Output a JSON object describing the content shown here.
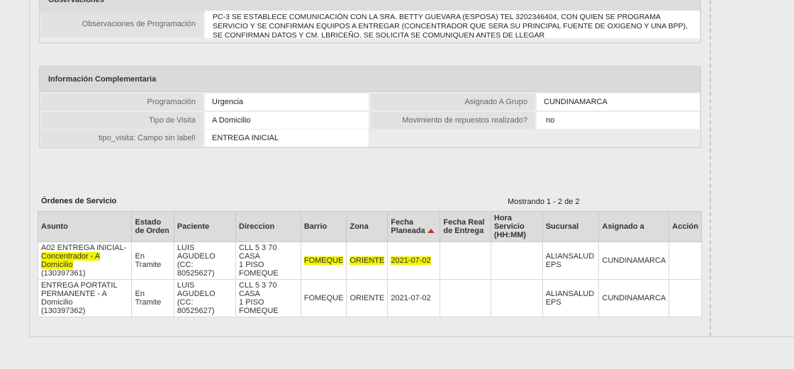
{
  "observaciones": {
    "header": "Observaciones",
    "label": "Observaciones de Programación",
    "value": "PC-3 SE ESTABLECE COMUNICACIÓN CON LA SRA. BETTY GUEVARA (ESPOSA) TEL 3202346404, CON QUIEN SE PROGRAMA SERVICIO Y SE CONFIRMAN EQUIPOS A ENTREGAR (CONCENTRADOR QUE SERA SU PRINCIPAL FUENTE DE OXIGENO Y UNA BPP), SE CONFIRMAN DATOS Y CM. LBRICEÑO. SE SOLICITA SE COMUNIQUEN ANTES DE LLEGAR"
  },
  "info": {
    "header": "Información Complementaria",
    "programacion_label": "Programación",
    "programacion_value": "Urgencia",
    "asignado_label": "Asignado A Grupo",
    "asignado_value": "CUNDINAMARCA",
    "tipo_visita_label": "Tipo de Visita",
    "tipo_visita_value": "A Domicilio",
    "movimiento_label": "Movimiento de repuestos realizado?",
    "movimiento_value": "no",
    "campo_label": "tipo_visita: Campo sin label!",
    "campo_value": "ENTREGA INICIAL"
  },
  "orders": {
    "title": "Órdenes de Servicio",
    "count": "Mostrando 1 - 2 de 2",
    "columns": {
      "asunto": "Asunto",
      "estado": "Estado de Orden",
      "paciente": "Paciente",
      "direccion": "Direccion",
      "barrio": "Barrio",
      "zona": "Zona",
      "fecha_planeada": "Fecha Planeada",
      "fecha_real": "Fecha Real de Entrega",
      "hora": "Hora Servicio (HH:MM)",
      "sucursal": "Sucursal",
      "asignado": "Asignado a",
      "accion": "Acción"
    },
    "rows": [
      {
        "asunto_a": "A02 ENTREGA INICIAL-",
        "asunto_b": "Concentrador - A Domicilio",
        "asunto_c": "(130397361)",
        "estado": "En Tramite",
        "paciente_a": "LUIS AGUDELO",
        "paciente_b": "(CC: 80525627)",
        "direccion_a": "CLL 5 3 70 CASA",
        "direccion_b": "1 PISO FOMEQUE",
        "barrio": "FOMEQUE",
        "zona": "ORIENTE",
        "fecha_planeada": "2021-07-02",
        "fecha_real": "",
        "hora": "",
        "sucursal_a": "ALIANSALUD",
        "sucursal_b": "EPS",
        "asignado": "CUNDINAMARCA",
        "accion": ""
      },
      {
        "asunto_a": "ENTREGA PORTATIL",
        "asunto_b": "PERMANENTE - A Domicilio",
        "asunto_c": "(130397362)",
        "estado": "En Tramite",
        "paciente_a": "LUIS AGUDELO",
        "paciente_b": "(CC: 80525627)",
        "direccion_a": "CLL 5 3 70 CASA",
        "direccion_b": "1 PISO FOMEQUE",
        "barrio": "FOMEQUE",
        "zona": "ORIENTE",
        "fecha_planeada": "2021-07-02",
        "fecha_real": "",
        "hora": "",
        "sucursal_a": "ALIANSALUD",
        "sucursal_b": "EPS",
        "asignado": "CUNDINAMARCA",
        "accion": ""
      }
    ]
  },
  "colors": {
    "highlight": "#f2f200",
    "sort_indicator": "#c0392b"
  }
}
